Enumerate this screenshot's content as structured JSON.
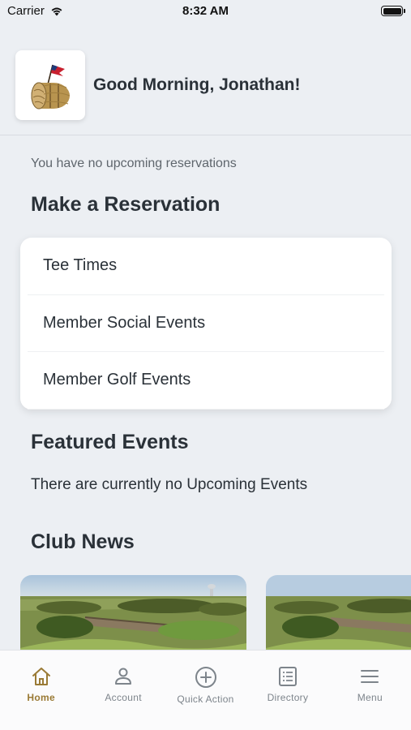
{
  "status": {
    "carrier": "Carrier",
    "time": "8:32 AM"
  },
  "header": {
    "greeting": "Good Morning, Jonathan!",
    "logo_icon": "club-logo-hay-bale-flag-icon"
  },
  "reservations": {
    "empty_text": "You have no upcoming reservations"
  },
  "make_reservation": {
    "title": "Make a Reservation",
    "items": [
      {
        "label": "Tee Times"
      },
      {
        "label": "Member Social Events"
      },
      {
        "label": "Member Golf Events"
      }
    ]
  },
  "featured": {
    "title": "Featured Events",
    "empty_text": "There are currently no Upcoming Events"
  },
  "news": {
    "title": "Club News",
    "cards": 2
  },
  "tabbar": {
    "items": [
      {
        "label": "Home",
        "icon": "home-icon",
        "active": true
      },
      {
        "label": "Account",
        "icon": "user-icon",
        "active": false
      },
      {
        "label": "Quick Action",
        "icon": "plus-circle-icon",
        "active": false
      },
      {
        "label": "Directory",
        "icon": "directory-list-icon",
        "active": false
      },
      {
        "label": "Menu",
        "icon": "hamburger-menu-icon",
        "active": false
      }
    ]
  },
  "colors": {
    "accent": "#9a7a35",
    "background": "#eceff3",
    "text": "#2a3138",
    "muted": "#7d848b"
  }
}
